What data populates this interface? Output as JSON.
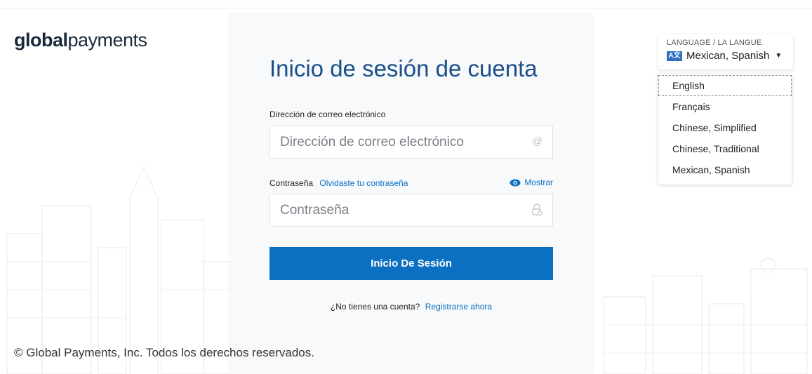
{
  "brand": {
    "logo_bold": "global",
    "logo_light": "payments"
  },
  "login": {
    "title": "Inicio de sesión de cuenta",
    "email_label": "Dirección de correo electrónico",
    "email_placeholder": "Dirección de correo electrónico",
    "email_icon": "at-icon",
    "password_label": "Contraseña",
    "forgot_link": "Olvidaste tu contraseña",
    "show_label": "Mostrar",
    "show_icon": "eye-icon",
    "password_placeholder": "Contraseña",
    "password_icon": "lock-icon",
    "submit_label": "Inicio De Sesión",
    "no_account_text": "¿No tienes una cuenta?",
    "signup_link": "Registrarse ahora"
  },
  "footer": {
    "copyright": "© Global Payments, Inc. Todos los derechos reservados."
  },
  "language": {
    "caption": "LANGUAGE / LA LANGUE",
    "selected": "Mexican, Spanish",
    "options": [
      "English",
      "Français",
      "Chinese, Simplified",
      "Chinese, Traditional",
      "Mexican, Spanish"
    ],
    "focused_option": "English"
  },
  "colors": {
    "accent": "#0b6fc2",
    "title": "#1a4f8a",
    "card_bg": "#f7f9fb"
  }
}
